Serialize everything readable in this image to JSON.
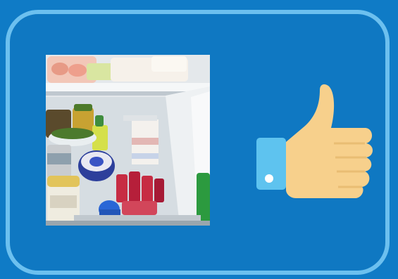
{
  "screen": {
    "background_color": "#0f7bc6",
    "card_border_color": "#6cc0ef"
  },
  "photo": {
    "subject": "open-refrigerator-photo"
  },
  "icon": {
    "name": "thumbs-up-icon",
    "skin_color": "#f7d08c",
    "cuff_color": "#5ec3ef"
  }
}
